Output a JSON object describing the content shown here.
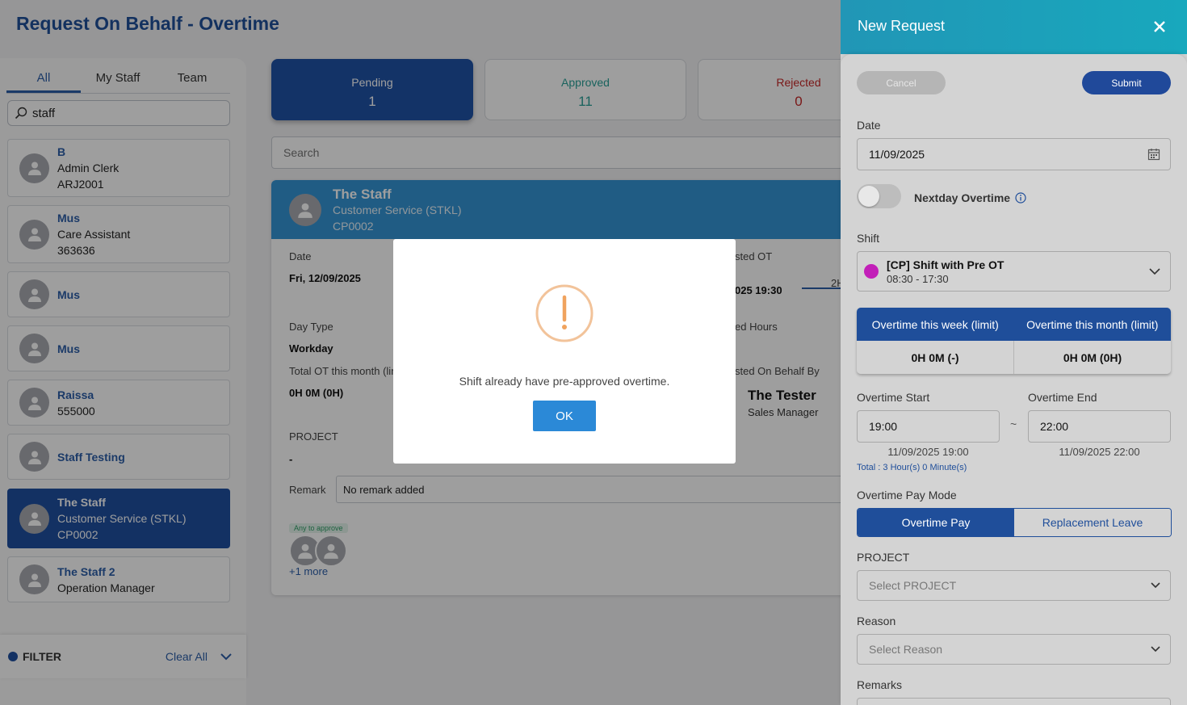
{
  "page": {
    "title": "Request On Behalf - Overtime"
  },
  "left": {
    "tabs": [
      "All",
      "My Staff",
      "Team"
    ],
    "search_value": "staff",
    "staff": [
      {
        "name": "B",
        "line1": "Admin Clerk",
        "line2": "ARJ2001"
      },
      {
        "name": "Mus",
        "line1": "Care Assistant",
        "line2": "363636"
      },
      {
        "name": "Mus"
      },
      {
        "name": "Mus"
      },
      {
        "name": "Raissa",
        "line1": "555000"
      },
      {
        "name": "Staff Testing"
      },
      {
        "name": "The Staff",
        "line1": "Customer Service (STKL)",
        "line2": "CP0002"
      },
      {
        "name": "The Staff 2",
        "line1": "Operation Manager"
      }
    ],
    "filter_label": "FILTER",
    "clear_all": "Clear All"
  },
  "stats": {
    "pending": {
      "label": "Pending",
      "count": "1"
    },
    "approved": {
      "label": "Approved",
      "count": "11",
      "color": "#2aa198"
    },
    "rejected": {
      "label": "Rejected",
      "count": "0",
      "color": "#c62828"
    }
  },
  "main": {
    "search_placeholder": "Search",
    "detail": {
      "name": "The Staff",
      "department": "Customer Service (STKL)",
      "code": "CP0002",
      "date_label": "Date",
      "date_value": "Fri, 12/09/2025",
      "requested_ot_label": "sted OT",
      "requested_ot_value": "025 19:30",
      "duration_partial": "2H",
      "day_type_label": "Day Type",
      "day_type_value": "Workday",
      "hours_label": "ed Hours",
      "total_ot_label": "Total OT this month (lim",
      "total_ot_value": "0H 0M (0H)",
      "behalf_label": "sted On Behalf By",
      "behalf_name": "The Tester",
      "behalf_role": "Sales Manager",
      "project_label": "PROJECT",
      "project_value": "-",
      "remark_label": "Remark",
      "remark_value": "No remark added",
      "approve_badge": "Any to approve",
      "more_link": "+1 more"
    }
  },
  "panel": {
    "title": "New Request",
    "cancel": "Cancel",
    "submit": "Submit",
    "date_label": "Date",
    "date_value": "11/09/2025",
    "nextday_label": "Nextday Overtime",
    "shift_label": "Shift",
    "shift_name": "[CP] Shift with Pre OT",
    "shift_time": "08:30 - 17:30",
    "shift_color": "#c21fb8",
    "week_limit_label": "Overtime this week (limit)",
    "month_limit_label": "Overtime this month (limit)",
    "week_limit_value": "0H 0M (-)",
    "month_limit_value": "0H 0M (0H)",
    "ot_start_label": "Overtime Start",
    "ot_end_label": "Overtime End",
    "ot_start_value": "19:00",
    "ot_end_value": "22:00",
    "ot_start_full": "11/09/2025 19:00",
    "ot_end_full": "11/09/2025 22:00",
    "tilde": "~",
    "total": "Total : 3 Hour(s) 0 Minute(s)",
    "pay_mode_label": "Overtime Pay Mode",
    "pay_mode_options": [
      "Overtime Pay",
      "Replacement Leave"
    ],
    "project_label": "PROJECT",
    "project_placeholder": "Select PROJECT",
    "reason_label": "Reason",
    "reason_placeholder": "Select Reason",
    "remarks_label": "Remarks"
  },
  "modal": {
    "message": "Shift already have pre-approved overtime.",
    "ok": "OK",
    "icon_color": "#f0a35e"
  }
}
